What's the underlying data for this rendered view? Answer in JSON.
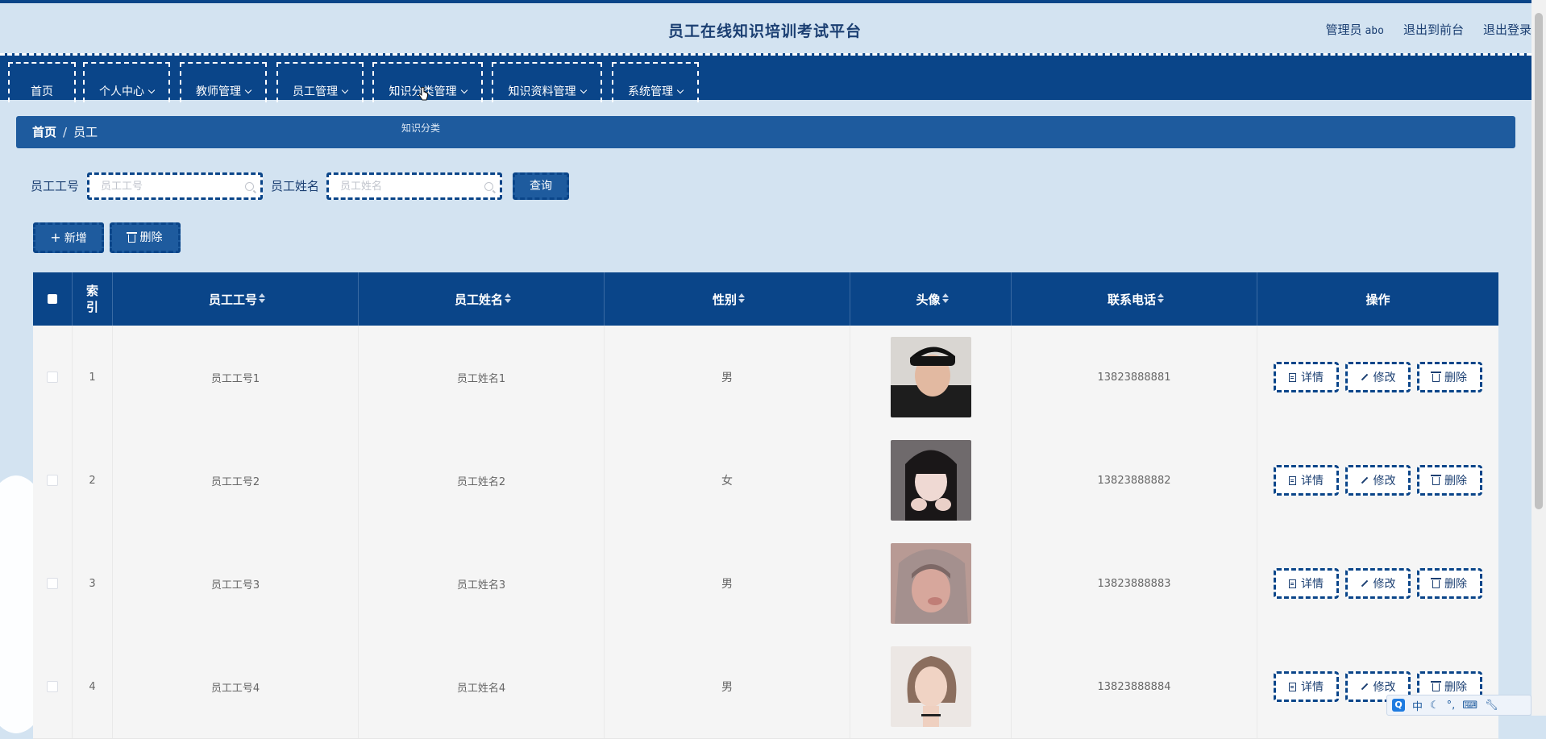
{
  "header": {
    "title": "员工在线知识培训考试平台",
    "user_role": "管理员",
    "user_name": "abo",
    "to_front": "退出到前台",
    "logout": "退出登录"
  },
  "nav": {
    "items": [
      {
        "label": "首页"
      },
      {
        "label": "个人中心"
      },
      {
        "label": "教师管理"
      },
      {
        "label": "员工管理"
      },
      {
        "label": "知识分类管理"
      },
      {
        "label": "知识资料管理"
      },
      {
        "label": "系统管理"
      }
    ],
    "dropdown_item": "知识分类"
  },
  "breadcrumb": {
    "home": "首页",
    "current": "员工"
  },
  "search": {
    "id_label": "员工工号",
    "id_placeholder": "员工工号",
    "name_label": "员工姓名",
    "name_placeholder": "员工姓名",
    "query_button": "查询"
  },
  "actions": {
    "add": "新增",
    "delete": "删除"
  },
  "table": {
    "headers": {
      "index": "索引",
      "emp_id": "员工工号",
      "emp_name": "员工姓名",
      "gender": "性别",
      "avatar": "头像",
      "phone": "联系电话",
      "ops": "操作"
    },
    "op_labels": {
      "detail": "详情",
      "edit": "修改",
      "delete": "删除"
    },
    "rows": [
      {
        "index": "1",
        "emp_id": "员工工号1",
        "emp_name": "员工姓名1",
        "gender": "男",
        "phone": "13823888881"
      },
      {
        "index": "2",
        "emp_id": "员工工号2",
        "emp_name": "员工姓名2",
        "gender": "女",
        "phone": "13823888882"
      },
      {
        "index": "3",
        "emp_id": "员工工号3",
        "emp_name": "员工姓名3",
        "gender": "男",
        "phone": "13823888883"
      },
      {
        "index": "4",
        "emp_id": "员工工号4",
        "emp_name": "员工姓名4",
        "gender": "男",
        "phone": "13823888884"
      }
    ]
  },
  "ime": {
    "mode": "中"
  },
  "colors": {
    "primary": "#0a4589",
    "accent": "#1e5b9e",
    "background": "#d3e3f1"
  }
}
